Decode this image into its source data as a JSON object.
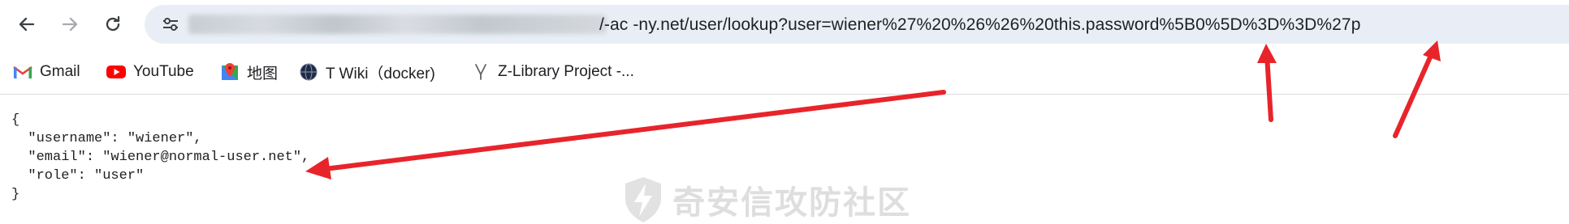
{
  "toolbar": {
    "back_icon": "arrow-left-icon",
    "forward_icon": "arrow-right-icon",
    "reload_icon": "reload-icon",
    "site_info_icon": "tune-icon",
    "url_visible": "/-ac   -ny.net/user/lookup?user=wiener%27%20%26%26%20this.password%5B0%5D%3D%3D%27p"
  },
  "bookmarks": [
    {
      "icon": "gmail-icon",
      "label": "Gmail"
    },
    {
      "icon": "youtube-icon",
      "label": "YouTube"
    },
    {
      "icon": "maps-icon",
      "label": "地图"
    },
    {
      "icon": "globe-icon",
      "label": "T Wiki（docker)"
    },
    {
      "icon": "zlibrary-icon",
      "label": "Z-Library Project -..."
    }
  ],
  "content": {
    "json_text": "{\n  \"username\": \"wiener\",\n  \"email\": \"wiener@normal-user.net\",\n  \"role\": \"user\"\n}"
  },
  "watermark": {
    "text": "奇安信攻防社区"
  },
  "colors": {
    "annotation_red": "#e8242b",
    "omnibox_bg": "#e9eef6"
  }
}
